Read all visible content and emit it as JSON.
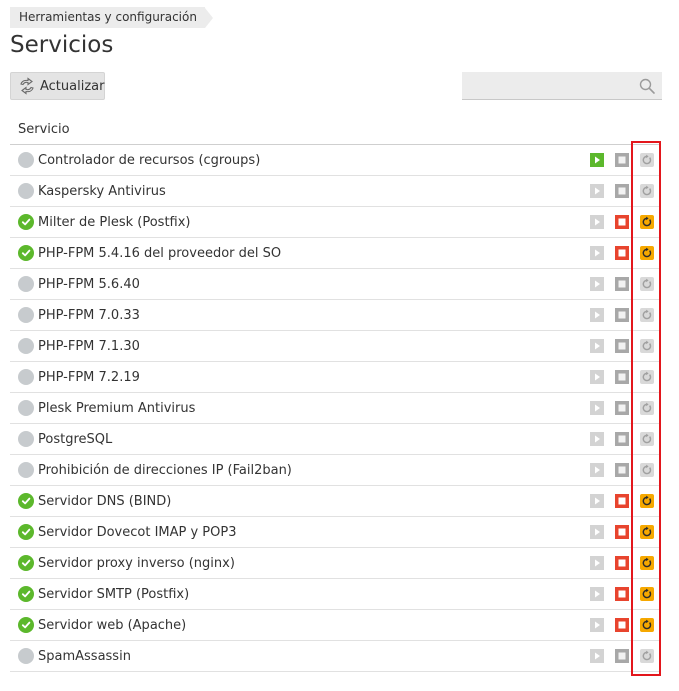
{
  "breadcrumb": {
    "label": "Herramientas y configuración"
  },
  "page": {
    "title": "Servicios"
  },
  "toolbar": {
    "refresh_label": "Actualizar",
    "refresh_icon": "refresh-arrows-icon"
  },
  "search": {
    "value": "",
    "placeholder": "",
    "icon": "search-icon"
  },
  "table": {
    "header_service": "Servicio",
    "rows": [
      {
        "name": "Controlador de recursos (cgroups)",
        "running": false,
        "start_enabled": true,
        "stop_enabled": false,
        "restart_enabled": false
      },
      {
        "name": "Kaspersky Antivirus",
        "running": false,
        "start_enabled": false,
        "stop_enabled": false,
        "restart_enabled": false
      },
      {
        "name": "Milter de Plesk (Postfix)",
        "running": true,
        "start_enabled": false,
        "stop_enabled": true,
        "restart_enabled": true
      },
      {
        "name": "PHP-FPM 5.4.16 del proveedor del SO",
        "running": true,
        "start_enabled": false,
        "stop_enabled": true,
        "restart_enabled": true
      },
      {
        "name": "PHP-FPM 5.6.40",
        "running": false,
        "start_enabled": false,
        "stop_enabled": false,
        "restart_enabled": false
      },
      {
        "name": "PHP-FPM 7.0.33",
        "running": false,
        "start_enabled": false,
        "stop_enabled": false,
        "restart_enabled": false
      },
      {
        "name": "PHP-FPM 7.1.30",
        "running": false,
        "start_enabled": false,
        "stop_enabled": false,
        "restart_enabled": false
      },
      {
        "name": "PHP-FPM 7.2.19",
        "running": false,
        "start_enabled": false,
        "stop_enabled": false,
        "restart_enabled": false
      },
      {
        "name": "Plesk Premium Antivirus",
        "running": false,
        "start_enabled": false,
        "stop_enabled": false,
        "restart_enabled": false
      },
      {
        "name": "PostgreSQL",
        "running": false,
        "start_enabled": false,
        "stop_enabled": false,
        "restart_enabled": false
      },
      {
        "name": "Prohibición de direcciones IP (Fail2ban)",
        "running": false,
        "start_enabled": false,
        "stop_enabled": false,
        "restart_enabled": false
      },
      {
        "name": "Servidor DNS (BIND)",
        "running": true,
        "start_enabled": false,
        "stop_enabled": true,
        "restart_enabled": true
      },
      {
        "name": "Servidor Dovecot IMAP y POP3",
        "running": true,
        "start_enabled": false,
        "stop_enabled": true,
        "restart_enabled": true
      },
      {
        "name": "Servidor proxy inverso (nginx)",
        "running": true,
        "start_enabled": false,
        "stop_enabled": true,
        "restart_enabled": true
      },
      {
        "name": "Servidor SMTP (Postfix)",
        "running": true,
        "start_enabled": false,
        "stop_enabled": true,
        "restart_enabled": true
      },
      {
        "name": "Servidor web (Apache)",
        "running": true,
        "start_enabled": false,
        "stop_enabled": true,
        "restart_enabled": true
      },
      {
        "name": "SpamAssassin",
        "running": false,
        "start_enabled": false,
        "stop_enabled": false,
        "restart_enabled": false
      }
    ]
  },
  "colors": {
    "running": "#5cb82c",
    "stopped": "#c7cbce",
    "start_active": "#5cb82c",
    "stop_active": "#e8442e",
    "restart_active": "#f6a800",
    "highlight": "#e3161c"
  }
}
